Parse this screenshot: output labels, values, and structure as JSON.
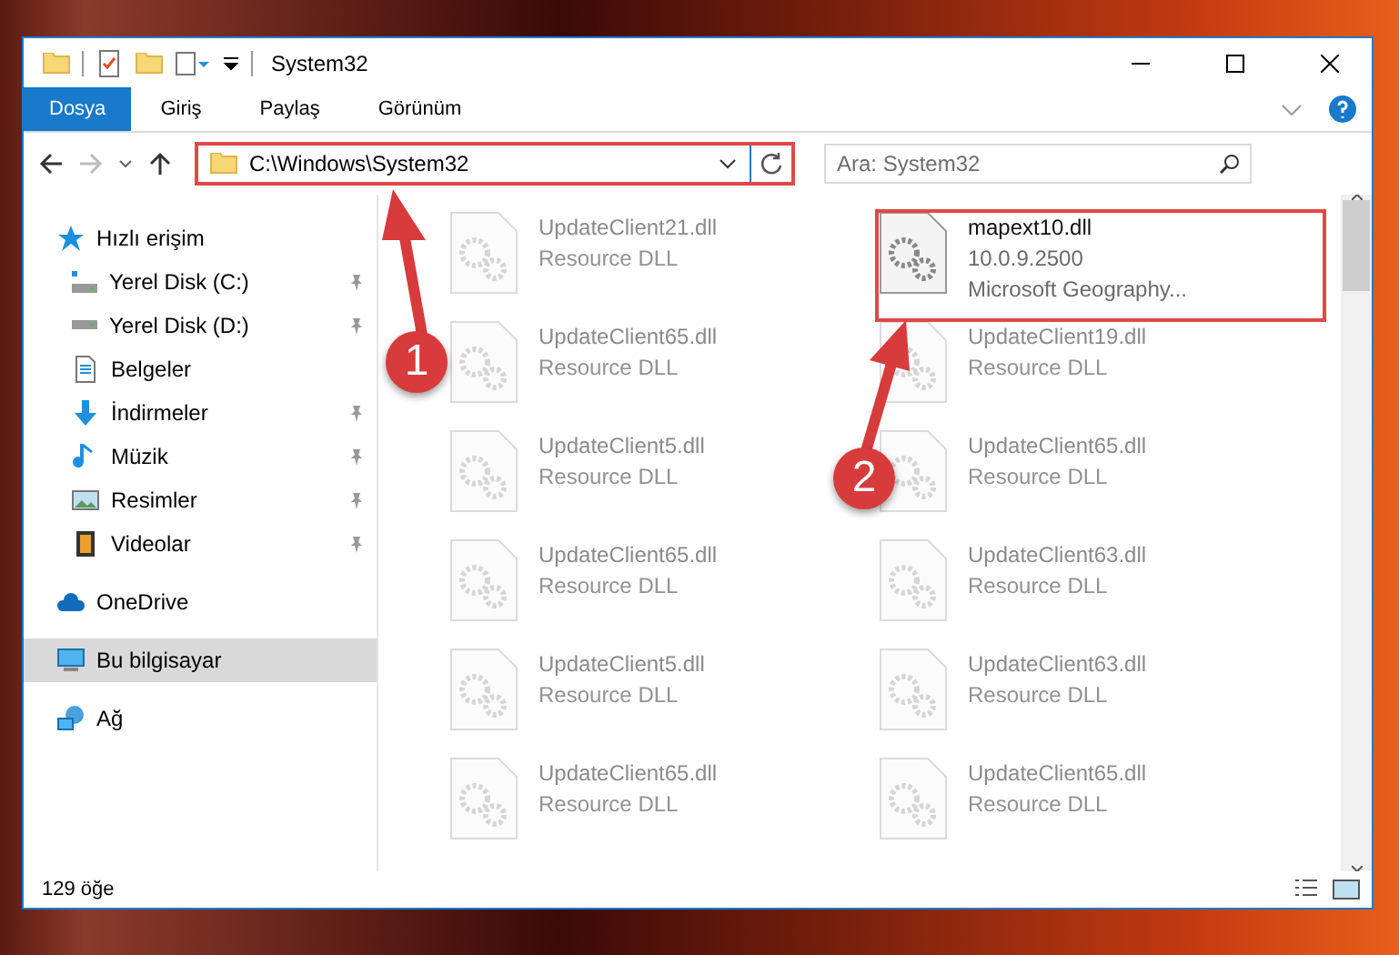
{
  "window": {
    "title": "System32"
  },
  "ribbon": {
    "tabs": [
      {
        "label": "Dosya",
        "kind": "file"
      },
      {
        "label": "Giriş",
        "kind": "tab"
      },
      {
        "label": "Paylaş",
        "kind": "tab"
      },
      {
        "label": "Görünüm",
        "kind": "tab"
      }
    ]
  },
  "navigation": {
    "back_disabled": false,
    "forward_disabled": true
  },
  "address": {
    "path": "C:\\Windows\\System32"
  },
  "search": {
    "placeholder": "Ara: System32"
  },
  "sidebar": {
    "items": [
      {
        "label": "Hızlı erişim",
        "selected": false,
        "children": [
          {
            "label": "Yerel Disk (C:)",
            "pinned": true,
            "selected": false
          },
          {
            "label": "Yerel Disk (D:)",
            "pinned": true,
            "selected": false
          },
          {
            "label": "Belgeler",
            "pinned": false,
            "selected": false
          },
          {
            "label": "İndirmeler",
            "pinned": true,
            "selected": false
          },
          {
            "label": "Müzik",
            "pinned": true,
            "selected": false
          },
          {
            "label": "Resimler",
            "pinned": true,
            "selected": false
          },
          {
            "label": "Videolar",
            "pinned": true,
            "selected": false
          }
        ]
      },
      {
        "label": "OneDrive",
        "selected": false
      },
      {
        "label": "Bu bilgisayar",
        "selected": true
      },
      {
        "label": "Ağ",
        "selected": false
      }
    ]
  },
  "files": {
    "columns": [
      [
        {
          "name": "UpdateClient21.dll",
          "lines": [
            "Resource DLL"
          ],
          "blurred": true
        },
        {
          "name": "UpdateClient65.dll",
          "lines": [
            "Resource DLL"
          ],
          "blurred": true
        },
        {
          "name": "UpdateClient5.dll",
          "lines": [
            "Resource DLL"
          ],
          "blurred": true
        },
        {
          "name": "UpdateClient65.dll",
          "lines": [
            "Resource DLL"
          ],
          "blurred": true
        },
        {
          "name": "UpdateClient5.dll",
          "lines": [
            "Resource DLL"
          ],
          "blurred": true
        },
        {
          "name": "UpdateClient65.dll",
          "lines": [
            "Resource DLL"
          ],
          "blurred": true
        }
      ],
      [
        {
          "name": "mapext10.dll",
          "lines": [
            "10.0.9.2500",
            "Microsoft Geography..."
          ],
          "blurred": false
        },
        {
          "name": "UpdateClient19.dll",
          "lines": [
            "Resource DLL"
          ],
          "blurred": true
        },
        {
          "name": "UpdateClient65.dll",
          "lines": [
            "Resource DLL"
          ],
          "blurred": true
        },
        {
          "name": "UpdateClient63.dll",
          "lines": [
            "Resource DLL"
          ],
          "blurred": true
        },
        {
          "name": "UpdateClient63.dll",
          "lines": [
            "Resource DLL"
          ],
          "blurred": true
        },
        {
          "name": "UpdateClient65.dll",
          "lines": [
            "Resource DLL"
          ],
          "blurred": true
        }
      ]
    ]
  },
  "status_bar": {
    "count": "129 öğe"
  },
  "annotations": [
    {
      "label": "1"
    },
    {
      "label": "2"
    }
  ]
}
